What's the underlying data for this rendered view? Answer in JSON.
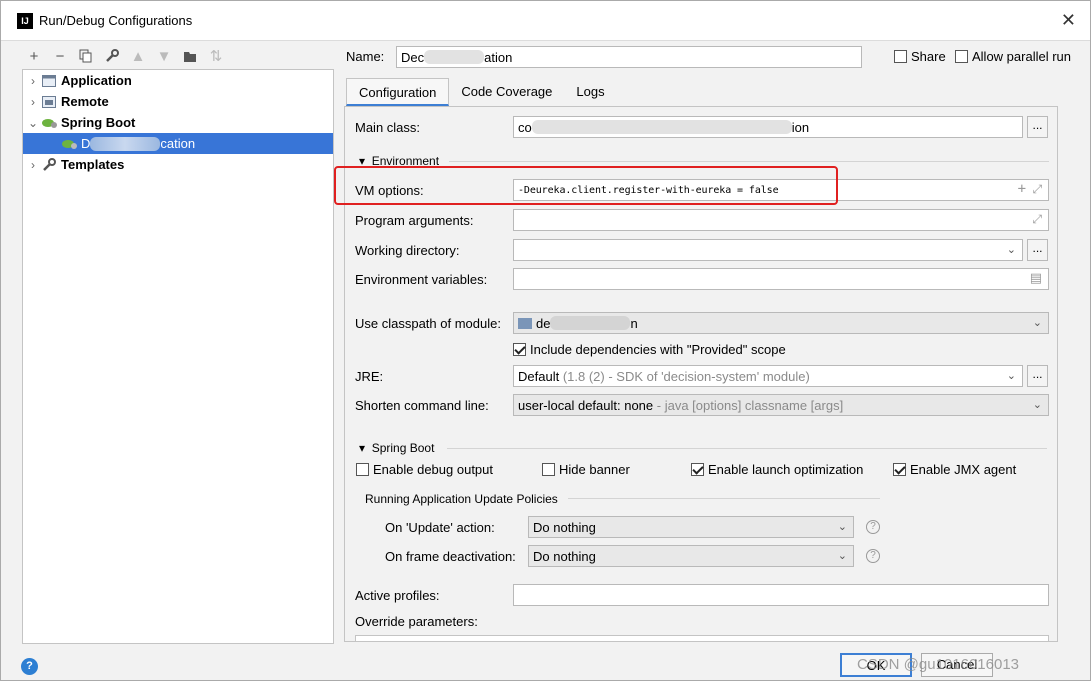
{
  "window": {
    "title": "Run/Debug Configurations",
    "app_icon": "IJ"
  },
  "left": {
    "toolbar": [
      "add-icon",
      "remove-icon",
      "copy-icon",
      "wrench-icon",
      "move-up-icon",
      "move-down-icon",
      "folder-add-icon",
      "sort-icon"
    ],
    "tree": [
      {
        "label": "Application",
        "icon": "application-icon"
      },
      {
        "label": "Remote",
        "icon": "remote-icon"
      },
      {
        "label": "Spring Boot",
        "icon": "spring-boot-icon"
      },
      {
        "label_start": "D",
        "label_end": "cation",
        "icon": "spring-boot-config-icon"
      },
      {
        "label": "Templates",
        "icon": "wrench-icon"
      }
    ]
  },
  "header": {
    "name_label": "Name:",
    "name_start": "Dec",
    "name_end": "ation",
    "share": "Share",
    "allow_parallel": "Allow parallel run"
  },
  "tabs": [
    "Configuration",
    "Code Coverage",
    "Logs"
  ],
  "config": {
    "main_class_label": "Main class:",
    "main_class_start": "co",
    "main_class_end": "ion",
    "environment": "Environment",
    "vm_options_label": "VM options:",
    "vm_options_value": "-Deureka.client.register-with-eureka = false",
    "program_args_label": "Program arguments:",
    "working_dir_label": "Working directory:",
    "env_vars_label": "Environment variables:",
    "classpath_label": "Use classpath of module:",
    "classpath_start": "de",
    "classpath_end": "n",
    "include_deps": "Include dependencies with \"Provided\" scope",
    "jre_label": "JRE:",
    "jre_value": "Default",
    "jre_hint": "(1.8 (2) - SDK of 'decision-system' module)",
    "shorten_label": "Shorten command line:",
    "shorten_value": "user-local default: none",
    "shorten_hint": " - java [options] classname [args]",
    "spring_boot": "Spring Boot",
    "enable_debug": "Enable debug output",
    "hide_banner": "Hide banner",
    "launch_opt": "Enable launch optimization",
    "jmx": "Enable JMX agent",
    "update_policies": "Running Application Update Policies",
    "on_update_label": "On 'Update' action:",
    "on_update_value": "Do nothing",
    "on_frame_label": "On frame deactivation:",
    "on_frame_value": "Do nothing",
    "active_profiles_label": "Active profiles:",
    "override_label": "Override parameters:"
  },
  "buttons": {
    "ok": "OK",
    "cancel": "Cancel"
  },
  "watermark": "CSDN @gu1016016013",
  "colors": {
    "selection": "#3875d7",
    "highlight_box": "#e02020",
    "tab_underline": "#3d7fd4"
  }
}
